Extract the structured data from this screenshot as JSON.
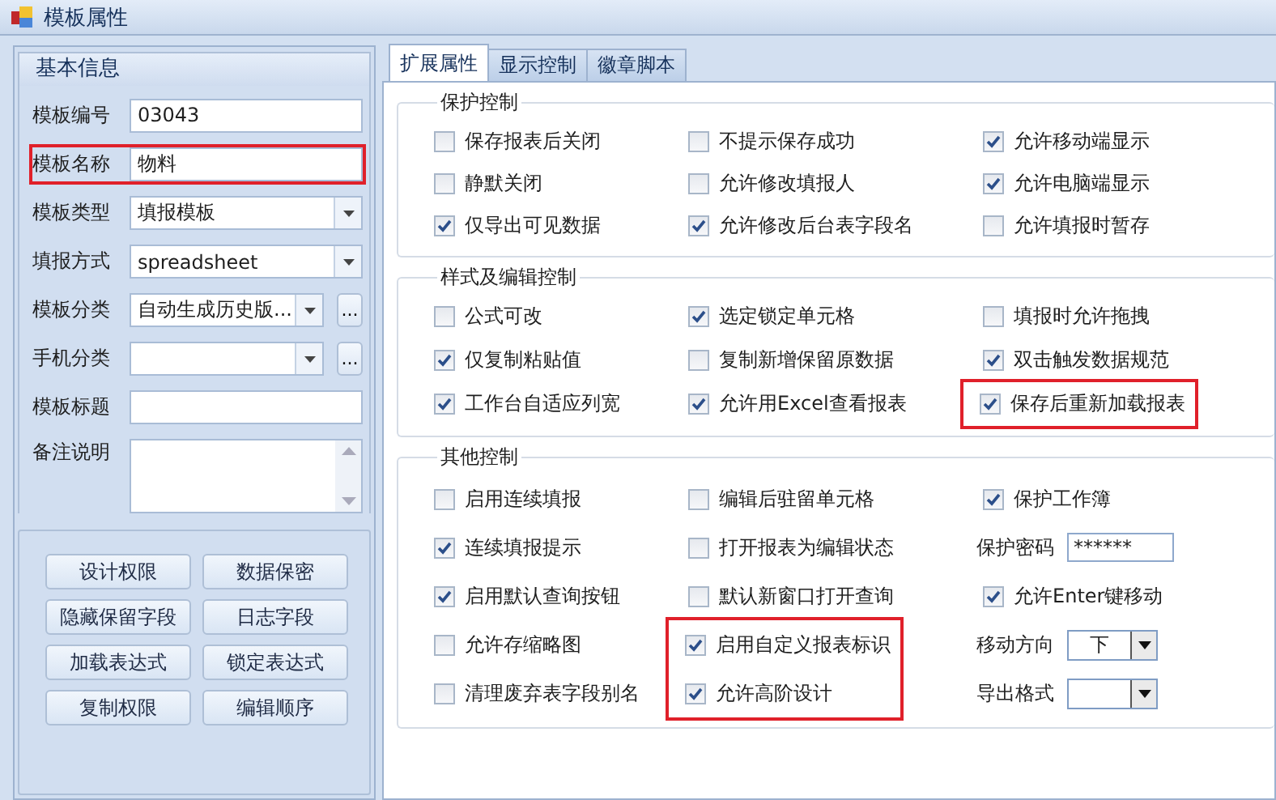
{
  "window": {
    "title": "模板属性"
  },
  "basic_info": {
    "title": "基本信息",
    "fields": [
      {
        "label": "模板编号",
        "kind": "text",
        "value": "03043",
        "highlighted": false
      },
      {
        "label": "模板名称",
        "kind": "text",
        "value": "物料",
        "highlighted": true
      },
      {
        "label": "模板类型",
        "kind": "select",
        "value": "填报模板",
        "highlighted": false
      },
      {
        "label": "填报方式",
        "kind": "select",
        "value": "spreadsheet",
        "highlighted": false
      },
      {
        "label": "模板分类",
        "kind": "select_more",
        "value": "自动生成历史版...",
        "more": "...",
        "highlighted": false
      },
      {
        "label": "手机分类",
        "kind": "select_more",
        "more": "...",
        "highlighted": false
      },
      {
        "label": "模板标题",
        "kind": "text",
        "highlighted": false
      },
      {
        "label": "备注说明",
        "kind": "textarea",
        "highlighted": false
      }
    ],
    "buttons": [
      "设计权限",
      "数据保密",
      "隐藏保留字段",
      "日志字段",
      "加载表达式",
      "锁定表达式",
      "复制权限",
      "编辑顺序"
    ]
  },
  "tabs": [
    {
      "label": "扩展属性",
      "selected": true
    },
    {
      "label": "显示控制",
      "selected": false
    },
    {
      "label": "徽章脚本",
      "selected": false
    }
  ],
  "sections": [
    {
      "title": "保护控制",
      "columns": [
        [
          {
            "kind": "checkbox",
            "label": "保存报表后关闭",
            "checked": false,
            "highlighted": false
          },
          {
            "kind": "checkbox",
            "label": "静默关闭",
            "checked": false,
            "highlighted": false
          },
          {
            "kind": "checkbox",
            "label": "仅导出可见数据",
            "checked": true,
            "highlighted": false
          }
        ],
        [
          {
            "kind": "checkbox",
            "label": "不提示保存成功",
            "checked": false,
            "highlighted": false
          },
          {
            "kind": "checkbox",
            "label": "允许修改填报人",
            "checked": false,
            "highlighted": false
          },
          {
            "kind": "checkbox",
            "label": "允许修改后台表字段名",
            "checked": true,
            "highlighted": false
          }
        ],
        [
          {
            "kind": "checkbox",
            "label": "允许移动端显示",
            "checked": true,
            "highlighted": false
          },
          {
            "kind": "checkbox",
            "label": "允许电脑端显示",
            "checked": true,
            "highlighted": false
          },
          {
            "kind": "checkbox",
            "label": "允许填报时暂存",
            "checked": false,
            "highlighted": false
          }
        ]
      ]
    },
    {
      "title": "样式及编辑控制",
      "columns": [
        [
          {
            "kind": "checkbox",
            "label": "公式可改",
            "checked": false,
            "highlighted": false
          },
          {
            "kind": "checkbox",
            "label": "仅复制粘贴值",
            "checked": true,
            "highlighted": false
          },
          {
            "kind": "checkbox",
            "label": "工作台自适应列宽",
            "checked": true,
            "highlighted": false
          }
        ],
        [
          {
            "kind": "checkbox",
            "label": "选定锁定单元格",
            "checked": true,
            "highlighted": false
          },
          {
            "kind": "checkbox",
            "label": "复制新增保留原数据",
            "checked": false,
            "highlighted": false
          },
          {
            "kind": "checkbox",
            "label": "允许用Excel查看报表",
            "checked": true,
            "highlighted": false
          }
        ],
        [
          {
            "kind": "checkbox",
            "label": "填报时允许拖拽",
            "checked": false,
            "highlighted": false
          },
          {
            "kind": "checkbox",
            "label": "双击触发数据规范",
            "checked": true,
            "highlighted": false
          },
          {
            "kind": "checkbox",
            "label": "保存后重新加载报表",
            "checked": true,
            "highlighted": true
          }
        ]
      ]
    },
    {
      "title": "其他控制",
      "columns": [
        [
          {
            "kind": "checkbox",
            "label": "启用连续填报",
            "checked": false,
            "highlighted": false
          },
          {
            "kind": "checkbox",
            "label": "连续填报提示",
            "checked": true,
            "highlighted": false
          },
          {
            "kind": "checkbox",
            "label": "启用默认查询按钮",
            "checked": true,
            "highlighted": false
          },
          {
            "kind": "checkbox",
            "label": "允许存缩略图",
            "checked": false,
            "highlighted": false
          },
          {
            "kind": "checkbox",
            "label": "清理废弃表字段别名",
            "checked": false,
            "highlighted": false
          }
        ],
        [
          {
            "kind": "checkbox",
            "label": "编辑后驻留单元格",
            "checked": false,
            "highlighted": false
          },
          {
            "kind": "checkbox",
            "label": "打开报表为编辑状态",
            "checked": false,
            "highlighted": false
          },
          {
            "kind": "checkbox",
            "label": "默认新窗口打开查询",
            "checked": false,
            "highlighted": false
          },
          {
            "kind": "checkbox",
            "label": "启用自定义报表标识",
            "checked": true,
            "highlighted": true
          },
          {
            "kind": "checkbox",
            "label": "允许高阶设计",
            "checked": true,
            "highlighted": true
          }
        ],
        [
          {
            "kind": "checkbox",
            "label": "保护工作簿",
            "checked": true,
            "highlighted": false
          },
          {
            "kind": "password",
            "label": "保护密码",
            "value": "******",
            "highlighted": false
          },
          {
            "kind": "checkbox",
            "label": "允许Enter键移动",
            "checked": true,
            "highlighted": false
          },
          {
            "kind": "select",
            "label": "移动方向",
            "value": "下",
            "highlighted": false
          },
          {
            "kind": "select",
            "label": "导出格式",
            "highlighted": false
          }
        ]
      ]
    }
  ]
}
